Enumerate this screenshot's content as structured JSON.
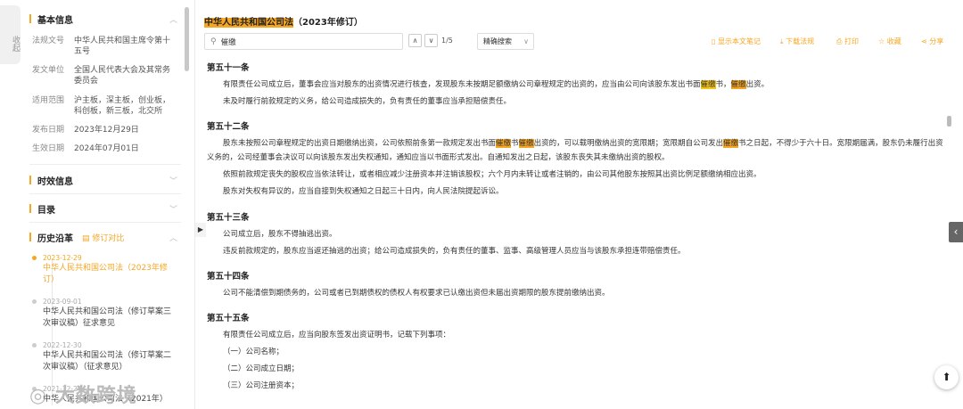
{
  "collapse_label": "收起",
  "sidebar": {
    "basic_info": {
      "heading": "基本信息",
      "rows": [
        {
          "key": "法规文号",
          "value": "中华人民共和国主席令第十五号"
        },
        {
          "key": "发文单位",
          "value": "全国人民代表大会及其常务委员会"
        },
        {
          "key": "适用范围",
          "value": "沪主板，深主板，创业板，科创板，新三板，北交所"
        },
        {
          "key": "发布日期",
          "value": "2023年12月29日"
        },
        {
          "key": "生效日期",
          "value": "2024年07月01日"
        }
      ]
    },
    "validity_heading": "时效信息",
    "toc_heading": "目录",
    "history": {
      "heading": "历史沿革",
      "compare_label": "修订对比",
      "items": [
        {
          "date": "2023-12-29",
          "title": "中华人民共和国公司法（2023年修订）"
        },
        {
          "date": "2023-09-01",
          "title": "中华人民共和国公司法（修订草案三次审议稿）征求意见"
        },
        {
          "date": "2022-12-30",
          "title": "中华人民共和国公司法（修订草案二次审议稿）（征求意见）"
        },
        {
          "date": "2021-12-24",
          "title": "中华人民共和国公司法（2021年）"
        }
      ]
    },
    "watermark": "大数跨境"
  },
  "main": {
    "title_highlight": "中华人民共和国公司法",
    "title_rest": "（2023年修订）",
    "search": {
      "value": "催缴",
      "count": "1/5"
    },
    "mode": "精确搜索",
    "toolbar": {
      "notes": "显示本文笔记",
      "download": "下载法规",
      "print": "打印",
      "favorite": "收藏",
      "share": "分享"
    },
    "articles": [
      {
        "heading": "第五十一条",
        "p1_a": "有限责任公司成立后，董事会应当对股东的出资情况进行核查，发现股东未按期足额缴纳公司章程规定的出资的，应当由公司向该股东发出书面",
        "p1_hl1": "催缴",
        "p1_b": "书，",
        "p1_hl2": "催缴",
        "p1_c": "出资。",
        "p2": "未及时履行前款规定的义务，给公司造成损失的，负有责任的董事应当承担赔偿责任。"
      },
      {
        "heading": "第五十二条",
        "p1_a": "股东未按照公司章程规定的出资日期缴纳出资，公司依照前条第一款规定发出书面",
        "p1_hl1": "催缴",
        "p1_b": "书",
        "p1_hl2": "催缴",
        "p1_c": "出资的，可以载明缴纳出资的宽限期；宽限期自公司发出",
        "p1_hl3": "催缴",
        "p1_d": "书之日起，不得少于六十日。宽限期届满，股东仍未履行出资义务的，公司经董事会决议可以向该股东发出失权通知，通知应当以书面形式发出。自通知发出之日起，该股东丧失其未缴纳出资的股权。",
        "p2": "依照前款规定丧失的股权应当依法转让，或者相应减少注册资本并注销该股权；六个月内未转让或者注销的，由公司其他股东按照其出资比例足额缴纳相应出资。",
        "p3": "股东对失权有异议的，应当自接到失权通知之日起三十日内，向人民法院提起诉讼。"
      },
      {
        "heading": "第五十三条",
        "p1": "公司成立后，股东不得抽逃出资。",
        "p2": "违反前款规定的，股东应当返还抽逃的出资；给公司造成损失的，负有责任的董事、监事、高级管理人员应当与该股东承担连带赔偿责任。"
      },
      {
        "heading": "第五十四条",
        "p1": "公司不能清偿到期债务的，公司或者已到期债权的债权人有权要求已认缴出资但未届出资期限的股东提前缴纳出资。"
      },
      {
        "heading": "第五十五条",
        "p1": "有限责任公司成立后，应当向股东签发出资证明书，记载下列事项：",
        "items": [
          "（一）公司名称；",
          "（二）公司成立日期；",
          "（三）公司注册资本；"
        ]
      }
    ]
  }
}
